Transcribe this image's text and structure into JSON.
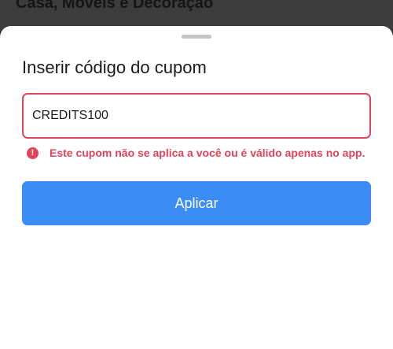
{
  "background": {
    "title": "Casa, Móveis e Decoração"
  },
  "sheet": {
    "title": "Inserir código do cupom",
    "coupon_input": {
      "value": "CREDITS100"
    },
    "error": {
      "icon": "alert-circle-icon",
      "icon_glyph": "!",
      "message": "Este cupom não se aplica a você ou é válido apenas no app."
    },
    "apply_button": {
      "label": "Aplicar"
    }
  },
  "colors": {
    "accent": "#3c8cf5",
    "error": "#e0445a"
  }
}
